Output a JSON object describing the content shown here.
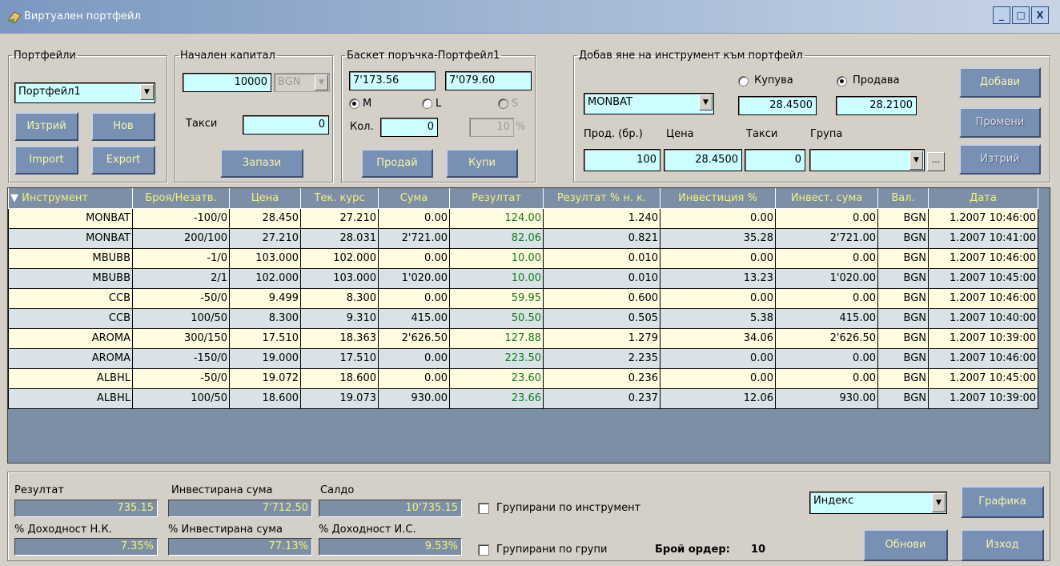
{
  "window": {
    "title": "Виртуален портфейл",
    "controls": [
      "_",
      "□",
      "X"
    ]
  },
  "portfolios": {
    "legend": "Портфейли",
    "selected": "Портфейл1",
    "delete_label": "Изтрий",
    "new_label": "Нов",
    "import_label": "Import",
    "export_label": "Export"
  },
  "capital": {
    "legend": "Начален капитал",
    "amount": "10000",
    "currency": "BGN",
    "fees_label": "Такси",
    "fees_value": "0",
    "save_label": "Запази"
  },
  "basket": {
    "legend": "Баскет поръчка-Портфейл1",
    "value1": "7'173.56",
    "value2": "7'079.60",
    "radio_m": "M",
    "radio_l": "L",
    "radio_s": "S",
    "qty_label": "Кол.",
    "qty_value": "0",
    "pct_value": "10",
    "pct_sign": "%",
    "sell_label": "Продай",
    "buy_label": "Купи"
  },
  "add_instrument": {
    "legend": "Добав яне на инструмент към портфейл",
    "instrument": "MONBAT",
    "buy_label": "Купува",
    "sell_label": "Продава",
    "buy_price": "28.4500",
    "sell_price": "28.2100",
    "qty_label": "Прод. (бр.)",
    "price_label": "Цена",
    "fees_label": "Такси",
    "group_label": "Група",
    "qty_value": "100",
    "price_value": "28.4500",
    "fees_value": "0",
    "group_value": "",
    "ellipsis": "...",
    "add_label": "Добави",
    "change_label": "Промени",
    "delete_label": "Изтрий"
  },
  "grid": {
    "columns": [
      "Инструмент",
      "Броя/Незатв.",
      "Цена",
      "Тек. курс",
      "Сума",
      "Резултат",
      "Резултат % н. к.",
      "Инвестиция %",
      "Инвест. сума",
      "Вал.",
      "Дата"
    ],
    "rows": [
      [
        "MONBAT",
        "-100/0",
        "28.450",
        "27.210",
        "0.00",
        "124.00",
        "1.240",
        "0.00",
        "0.00",
        "BGN",
        "1.2007 10:46:00"
      ],
      [
        "MONBAT",
        "200/100",
        "27.210",
        "28.031",
        "2'721.00",
        "82.06",
        "0.821",
        "35.28",
        "2'721.00",
        "BGN",
        "1.2007 10:41:00"
      ],
      [
        "MBUBB",
        "-1/0",
        "103.000",
        "102.000",
        "0.00",
        "10.00",
        "0.010",
        "0.00",
        "0.00",
        "BGN",
        "1.2007 10:46:00"
      ],
      [
        "MBUBB",
        "2/1",
        "102.000",
        "103.000",
        "1'020.00",
        "10.00",
        "0.010",
        "13.23",
        "1'020.00",
        "BGN",
        "1.2007 10:45:00"
      ],
      [
        "CCB",
        "-50/0",
        "9.499",
        "8.300",
        "0.00",
        "59.95",
        "0.600",
        "0.00",
        "0.00",
        "BGN",
        "1.2007 10:46:00"
      ],
      [
        "CCB",
        "100/50",
        "8.300",
        "9.310",
        "415.00",
        "50.50",
        "0.505",
        "5.38",
        "415.00",
        "BGN",
        "1.2007 10:40:00"
      ],
      [
        "AROMA",
        "300/150",
        "17.510",
        "18.363",
        "2'626.50",
        "127.88",
        "1.279",
        "34.06",
        "2'626.50",
        "BGN",
        "1.2007 10:39:00"
      ],
      [
        "AROMA",
        "-150/0",
        "19.000",
        "17.510",
        "0.00",
        "223.50",
        "2.235",
        "0.00",
        "0.00",
        "BGN",
        "1.2007 10:46:00"
      ],
      [
        "ALBHL",
        "-50/0",
        "19.072",
        "18.600",
        "0.00",
        "23.60",
        "0.236",
        "0.00",
        "0.00",
        "BGN",
        "1.2007 10:45:00"
      ],
      [
        "ALBHL",
        "100/50",
        "18.600",
        "19.073",
        "930.00",
        "23.66",
        "0.237",
        "12.06",
        "930.00",
        "BGN",
        "1.2007 10:39:00"
      ]
    ]
  },
  "summary": {
    "result_label": "Резултат",
    "result_value": "735.15",
    "invested_label": "Инвестирана сума",
    "invested_value": "7'712.50",
    "balance_label": "Салдо",
    "balance_value": "10'735.15",
    "yield_nk_label": "% Доходност Н.К.",
    "yield_nk_value": "7.35%",
    "invested_pct_label": "% Инвестирана сума",
    "invested_pct_value": "77.13%",
    "yield_is_label": "% Доходност И.С.",
    "yield_is_value": "9.53%",
    "group_by_instrument": "Групирани по инструмент",
    "group_by_groups": "Групирани по групи",
    "orders_label": "Брой ордер:",
    "orders_value": "10",
    "index_select": "Индекс",
    "chart_label": "Графика",
    "refresh_label": "Обнови",
    "exit_label": "Изход"
  },
  "colors": {
    "field_bg": "#ccfdff",
    "button_bg": "#7790b4",
    "button_text": "#fbf5a4",
    "positive": "#117a1a",
    "row_odd": "#fffce0",
    "row_even": "#d9e2e6"
  }
}
